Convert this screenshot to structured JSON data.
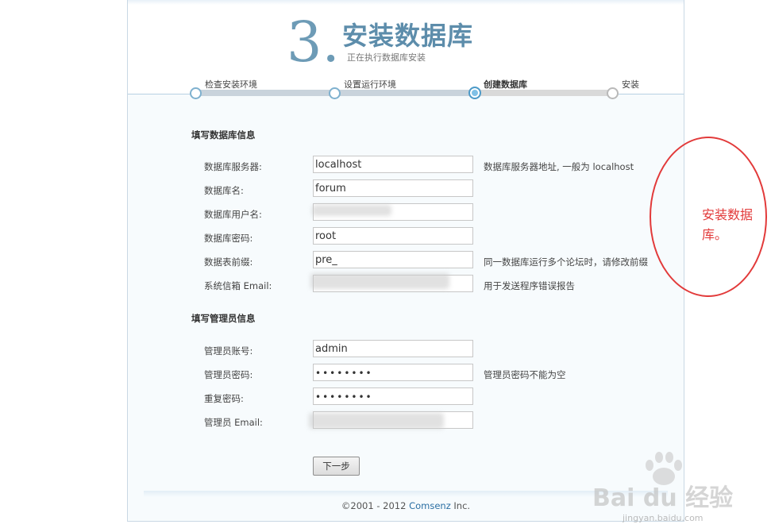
{
  "header": {
    "step_number": "3.",
    "title": "安装数据库",
    "subtitle": "正在执行数据库安装"
  },
  "steps": [
    {
      "label": "检查安装环境",
      "state": "done"
    },
    {
      "label": "设置运行环境",
      "state": "done"
    },
    {
      "label": "创建数据库",
      "state": "current"
    },
    {
      "label": "安装",
      "state": "todo"
    }
  ],
  "db_section": {
    "title": "填写数据库信息",
    "fields": [
      {
        "label": "数据库服务器:",
        "value": "localhost",
        "hint": "数据库服务器地址, 一般为 localhost"
      },
      {
        "label": "数据库名:",
        "value": "forum",
        "hint": ""
      },
      {
        "label": "数据库用户名:",
        "value": "",
        "hint": ""
      },
      {
        "label": "数据库密码:",
        "value": "root",
        "hint": ""
      },
      {
        "label": "数据表前缀:",
        "value": "pre_",
        "hint": "同一数据库运行多个论坛时，请修改前缀"
      },
      {
        "label": "系统信箱 Email:",
        "value": "",
        "hint": "用于发送程序错误报告"
      }
    ]
  },
  "admin_section": {
    "title": "填写管理员信息",
    "fields": [
      {
        "label": "管理员账号:",
        "value": "admin",
        "hint": ""
      },
      {
        "label": "管理员密码:",
        "value": "••••••••",
        "hint": "管理员密码不能为空"
      },
      {
        "label": "重复密码:",
        "value": "••••••••",
        "hint": ""
      },
      {
        "label": "管理员 Email:",
        "value": "",
        "hint": ""
      }
    ]
  },
  "next_button": "下一步",
  "footer": {
    "copyright": "©2001 - 2012 ",
    "brand": "Comsenz",
    "suffix": " Inc."
  },
  "annotation": {
    "text": "安装数据库。",
    "color": "#e23a3a"
  },
  "watermark": {
    "logo_text": "Bai du 经验",
    "url": "jingyan.baidu.com"
  },
  "colors": {
    "accent": "#5d8dab",
    "link": "#2b6fa3"
  }
}
